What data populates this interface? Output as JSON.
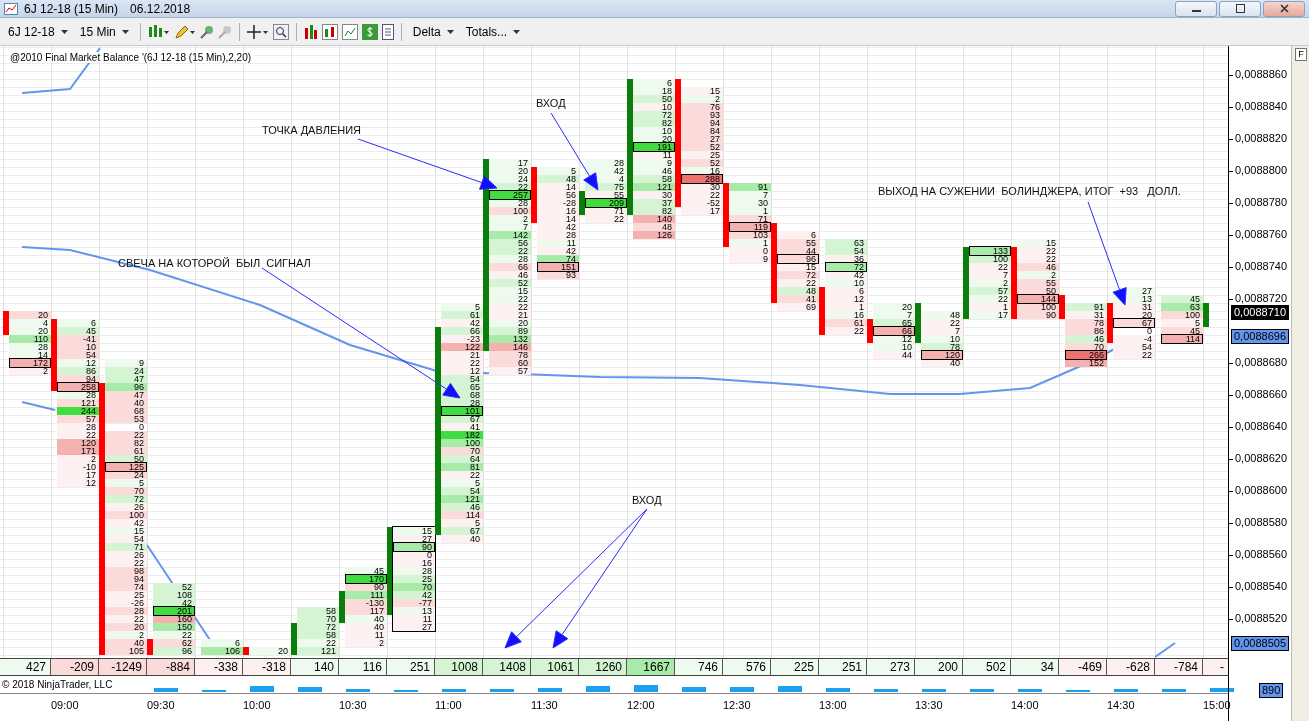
{
  "window": {
    "title": "6J 12-18 (15 Min)",
    "date": "06.12.2018"
  },
  "toolbar": {
    "instrument": "6J 12-18",
    "interval": "15 Min",
    "buttons": [
      "Delta",
      "Totals..."
    ]
  },
  "chart": {
    "indicator_label": "@2010 Final Market Balance  '(6J 12-18 (15 Min),2,20)",
    "options_button": "F",
    "price_labels": [
      "0,0088860",
      "0,0088840",
      "0,0088820",
      "0,0088800",
      "0,0088780",
      "0,0088760",
      "0,0088740",
      "0,0088720",
      "0,0088680",
      "0,0088660",
      "0,0088640",
      "0,0088620",
      "0,0088600",
      "0,0088580",
      "0,0088560",
      "0,0088540",
      "0,0088520"
    ],
    "price_markers": [
      {
        "text": "0,0088710",
        "kind": "last"
      },
      {
        "text": "0,0088696",
        "kind": "indicator"
      },
      {
        "text": "0,0088505",
        "kind": "indicator"
      }
    ],
    "time_labels": [
      "09:00",
      "09:30",
      "10:00",
      "10:30",
      "11:00",
      "11:30",
      "12:00",
      "12:30",
      "13:00",
      "13:30",
      "14:00",
      "14:30",
      "15:00"
    ],
    "annotations": [
      {
        "text": "ТОЧКА ДАВЛЕНИЯ"
      },
      {
        "text": "СВЕЧА НА КОТОРОЙ  БЫЛ  СИГНАЛ"
      },
      {
        "text": "ВХОД"
      },
      {
        "text": "ВХОД"
      },
      {
        "text": "ВЫХОД НА СУЖЕНИИ  БОЛИНДЖЕРА, ИТОГ  +93   ДОЛЛ."
      }
    ],
    "candles": [
      {
        "outlined": false,
        "bullish": false,
        "delta": {
          "text": "427",
          "color": "#effaef"
        },
        "cells": [
          {
            "text": "20",
            "color": "#fbdada",
            "poc": false
          },
          {
            "text": "4",
            "color": "#effaef",
            "poc": false
          },
          {
            "text": "20",
            "color": "#effaef",
            "poc": false
          },
          {
            "text": "110",
            "color": "#a8eba8",
            "poc": false
          },
          {
            "text": "28",
            "color": "#effaef",
            "poc": false
          },
          {
            "text": "14",
            "color": "#effaef",
            "poc": false
          },
          {
            "text": "172",
            "color": "#f5b0b0",
            "poc": true
          },
          {
            "text": "2",
            "color": "#fdf0f0",
            "poc": false
          }
        ]
      },
      {
        "outlined": false,
        "bullish": false,
        "delta": {
          "text": "-209",
          "color": "#fbdada"
        },
        "cells": [
          {
            "text": "6",
            "color": "#effaef",
            "poc": false
          },
          {
            "text": "45",
            "color": "#d4f4d4",
            "poc": false
          },
          {
            "text": "-41",
            "color": "#fbdada",
            "poc": false
          },
          {
            "text": "10",
            "color": "#fbdada",
            "poc": false
          },
          {
            "text": "54",
            "color": "#fbdada",
            "poc": false
          },
          {
            "text": "12",
            "color": "#effaef",
            "poc": false
          },
          {
            "text": "86",
            "color": "#d4f4d4",
            "poc": false
          },
          {
            "text": "94",
            "color": "#fbdada",
            "poc": false
          },
          {
            "text": "258",
            "color": "#f5b0b0",
            "poc": true
          },
          {
            "text": "28",
            "color": "#effaef",
            "poc": false
          },
          {
            "text": "121",
            "color": "#fbdada",
            "poc": false
          },
          {
            "text": "244",
            "color": "#40dc40",
            "poc": false
          },
          {
            "text": "57",
            "color": "#fbdada",
            "poc": false
          },
          {
            "text": "28",
            "color": "#fdf0f0",
            "poc": false
          },
          {
            "text": "22",
            "color": "#fdf0f0",
            "poc": false
          },
          {
            "text": "120",
            "color": "#f5b0b0",
            "poc": false
          },
          {
            "text": "171",
            "color": "#f5b0b0",
            "poc": false
          },
          {
            "text": "2",
            "color": "#fdf0f0",
            "poc": false
          },
          {
            "text": "-10",
            "color": "#fdf0f0",
            "poc": false
          },
          {
            "text": "17",
            "color": "#fdf0f0",
            "poc": false
          },
          {
            "text": "12",
            "color": "#fdf0f0",
            "poc": false
          }
        ]
      },
      {
        "outlined": false,
        "bullish": false,
        "delta": {
          "text": "-1249",
          "color": "#fbdada"
        },
        "cells": [
          {
            "text": "9",
            "color": "#effaef",
            "poc": false
          },
          {
            "text": "24",
            "color": "#d4f4d4",
            "poc": false
          },
          {
            "text": "47",
            "color": "#d4f4d4",
            "poc": false
          },
          {
            "text": "96",
            "color": "#a8eba8",
            "poc": false
          },
          {
            "text": "47",
            "color": "#fbdada",
            "poc": false
          },
          {
            "text": "40",
            "color": "#fbdada",
            "poc": false
          },
          {
            "text": "68",
            "color": "#fbdada",
            "poc": false
          },
          {
            "text": "53",
            "color": "#fbdada",
            "poc": false
          },
          {
            "text": "0",
            "poc": false
          },
          {
            "text": "22",
            "color": "#fbdada",
            "poc": false
          },
          {
            "text": "82",
            "color": "#fbdada",
            "poc": false
          },
          {
            "text": "61",
            "color": "#fbdada",
            "poc": false
          },
          {
            "text": "50",
            "color": "#d4f4d4",
            "poc": false
          },
          {
            "text": "125",
            "color": "#f5b0b0",
            "poc": true
          },
          {
            "text": "24",
            "color": "#fbdada",
            "poc": false
          },
          {
            "text": "5",
            "color": "#effaef",
            "poc": false
          },
          {
            "text": "70",
            "color": "#fbdada",
            "poc": false
          },
          {
            "text": "72",
            "color": "#d4f4d4",
            "poc": false
          },
          {
            "text": "26",
            "color": "#fdf0f0",
            "poc": false
          },
          {
            "text": "100",
            "color": "#fbdada",
            "poc": false
          },
          {
            "text": "42",
            "color": "#fdf0f0",
            "poc": false
          },
          {
            "text": "15",
            "color": "#effaef",
            "poc": false
          },
          {
            "text": "54",
            "color": "#fdf0f0",
            "poc": false
          },
          {
            "text": "71",
            "color": "#d4f4d4",
            "poc": false
          },
          {
            "text": "26",
            "color": "#fdf0f0",
            "poc": false
          },
          {
            "text": "22",
            "color": "#fdf0f0",
            "poc": false
          },
          {
            "text": "98",
            "color": "#fbdada",
            "poc": false
          },
          {
            "text": "94",
            "color": "#fbdada",
            "poc": false
          },
          {
            "text": "74",
            "color": "#fbdada",
            "poc": false
          },
          {
            "text": "25",
            "color": "#fdf0f0",
            "poc": false
          },
          {
            "text": "-26",
            "color": "#fdf0f0",
            "poc": false
          },
          {
            "text": "28",
            "color": "#fbdada",
            "poc": false
          },
          {
            "text": "22",
            "color": "#fdf0f0",
            "poc": false
          },
          {
            "text": "20",
            "color": "#fbdada",
            "poc": false
          },
          {
            "text": "2",
            "color": "#effaef",
            "poc": false
          },
          {
            "text": "40",
            "color": "#fbdada",
            "poc": false
          },
          {
            "text": "105",
            "color": "#fbdada",
            "poc": false
          }
        ]
      },
      {
        "outlined": false,
        "bullish": false,
        "delta": {
          "text": "-884",
          "color": "#fbdada"
        },
        "cells": [
          {
            "text": "52",
            "color": "#d4f4d4",
            "poc": false
          },
          {
            "text": "108",
            "color": "#d4f4d4",
            "poc": false
          },
          {
            "text": "42",
            "color": "#d4f4d4",
            "poc": false
          },
          {
            "text": "201",
            "color": "#40dc40",
            "poc": true
          },
          {
            "text": "160",
            "color": "#f5b0b0",
            "poc": false
          },
          {
            "text": "150",
            "color": "#a8eba8",
            "poc": false
          },
          {
            "text": "22",
            "color": "#effaef",
            "poc": false
          },
          {
            "text": "62",
            "color": "#fbdada",
            "poc": false
          },
          {
            "text": "96",
            "color": "#d4f4d4",
            "poc": false
          }
        ]
      },
      {
        "outlined": false,
        "delta": {
          "text": "-338",
          "color": "#fdf0f0"
        },
        "cells": [
          {
            "text": "6",
            "color": "#effaef",
            "poc": false
          },
          {
            "text": "106",
            "color": "#a8eba8",
            "poc": false
          }
        ]
      },
      {
        "outlined": false,
        "bullish": false,
        "delta": {
          "text": "-318",
          "color": "#fdf0f0"
        },
        "cells": [
          {
            "text": "20",
            "color": "#effaef",
            "poc": false
          }
        ]
      },
      {
        "outlined": false,
        "bullish": true,
        "delta": {
          "text": "140",
          "color": "#effaef"
        },
        "cells": [
          {
            "text": "58",
            "color": "#d4f4d4",
            "poc": false
          },
          {
            "text": "70",
            "color": "#d4f4d4",
            "poc": false
          },
          {
            "text": "72",
            "color": "#d4f4d4",
            "poc": false
          },
          {
            "text": "58",
            "color": "#d4f4d4",
            "poc": false
          },
          {
            "text": "22",
            "color": "#effaef",
            "poc": false
          },
          {
            "text": "121",
            "color": "#d4f4d4",
            "poc": false
          }
        ]
      },
      {
        "outlined": false,
        "bullish": true,
        "delta": {
          "text": "116",
          "color": "#effaef"
        },
        "cells": [
          {
            "text": "45",
            "color": "#effaef",
            "poc": false
          },
          {
            "text": "170",
            "color": "#40dc40",
            "poc": true
          },
          {
            "text": "90",
            "color": "#fbdada",
            "poc": false
          },
          {
            "text": "111",
            "color": "#a8eba8",
            "poc": false
          },
          {
            "text": "-130",
            "color": "#fbdada",
            "poc": false
          },
          {
            "text": "117",
            "color": "#fbdada",
            "poc": false
          },
          {
            "text": "40",
            "color": "#effaef",
            "poc": false
          },
          {
            "text": "40",
            "color": "#fdf0f0",
            "poc": false
          },
          {
            "text": "11",
            "color": "#fdf0f0",
            "poc": false
          },
          {
            "text": "2",
            "color": "#fdf0f0",
            "poc": false
          }
        ]
      },
      {
        "outlined": true,
        "bullish": true,
        "delta": {
          "text": "251",
          "color": "#effaef"
        },
        "cells": [
          {
            "text": "15",
            "color": "#effaef",
            "poc": false
          },
          {
            "text": "27",
            "color": "#fdf0f0",
            "poc": false
          },
          {
            "text": "90",
            "color": "#a8eba8",
            "poc": true
          },
          {
            "text": "0",
            "color": "#fdf0f0",
            "poc": false
          },
          {
            "text": "16",
            "color": "#fdf0f0",
            "poc": false
          },
          {
            "text": "28",
            "color": "#effaef",
            "poc": false
          },
          {
            "text": "25",
            "color": "#d4f4d4",
            "poc": false
          },
          {
            "text": "70",
            "color": "#a8eba8",
            "poc": false
          },
          {
            "text": "42",
            "color": "#d4f4d4",
            "poc": false
          },
          {
            "text": "-77",
            "color": "#fbdada",
            "poc": false
          },
          {
            "text": "13",
            "color": "#effaef",
            "poc": false
          },
          {
            "text": "11",
            "color": "#fdf0f0",
            "poc": false
          },
          {
            "text": "27",
            "color": "#fdf0f0",
            "poc": false
          }
        ]
      },
      {
        "outlined": false,
        "bullish": true,
        "delta": {
          "text": "1008",
          "color": "#d4f4d4"
        },
        "cells": [
          {
            "text": "5",
            "color": "#effaef",
            "poc": false
          },
          {
            "text": "61",
            "color": "#d4f4d4",
            "poc": false
          },
          {
            "text": "42",
            "color": "#fdf0f0",
            "poc": false
          },
          {
            "text": "66",
            "color": "#d4f4d4",
            "poc": false
          },
          {
            "text": "-23",
            "color": "#fdf0f0",
            "poc": false
          },
          {
            "text": "122",
            "color": "#f5b0b0",
            "poc": false
          },
          {
            "text": "21",
            "color": "#fdf0f0",
            "poc": false
          },
          {
            "text": "22",
            "color": "#fdf0f0",
            "poc": false
          },
          {
            "text": "12",
            "color": "#fdf0f0",
            "poc": false
          },
          {
            "text": "54",
            "color": "#d4f4d4",
            "poc": false
          },
          {
            "text": "65",
            "color": "#d4f4d4",
            "poc": false
          },
          {
            "text": "68",
            "color": "#d4f4d4",
            "poc": false
          },
          {
            "text": "28",
            "color": "#d4f4d4",
            "poc": false
          },
          {
            "text": "101",
            "color": "#40dc40",
            "poc": true
          },
          {
            "text": "67",
            "color": "#d4f4d4",
            "poc": false
          },
          {
            "text": "41",
            "color": "#fdf0f0",
            "poc": false
          },
          {
            "text": "182",
            "color": "#40dc40",
            "poc": false
          },
          {
            "text": "100",
            "color": "#a8eba8",
            "poc": false
          },
          {
            "text": "70",
            "color": "#fbdada",
            "poc": false
          },
          {
            "text": "64",
            "color": "#d4f4d4",
            "poc": false
          },
          {
            "text": "81",
            "color": "#a8eba8",
            "poc": false
          },
          {
            "text": "22",
            "color": "#fdf0f0",
            "poc": false
          },
          {
            "text": "5",
            "color": "#effaef",
            "poc": false
          },
          {
            "text": "54",
            "color": "#d4f4d4",
            "poc": false
          },
          {
            "text": "121",
            "color": "#a8eba8",
            "poc": false
          },
          {
            "text": "46",
            "color": "#d4f4d4",
            "poc": false
          },
          {
            "text": "114",
            "color": "#fbdada",
            "poc": false
          },
          {
            "text": "5",
            "color": "#fdf0f0",
            "poc": false
          },
          {
            "text": "67",
            "color": "#d4f4d4",
            "poc": false
          },
          {
            "text": "40",
            "color": "#fdf0f0",
            "poc": false
          }
        ]
      },
      {
        "outlined": false,
        "bullish": true,
        "delta": {
          "text": "1408",
          "color": "#d4f4d4"
        },
        "cells": [
          {
            "text": "17",
            "color": "#effaef",
            "poc": false
          },
          {
            "text": "20",
            "color": "#effaef",
            "poc": false
          },
          {
            "text": "24",
            "color": "#effaef",
            "poc": false
          },
          {
            "text": "22",
            "color": "#d4f4d4",
            "poc": false
          },
          {
            "text": "257",
            "color": "#40dc40",
            "poc": true
          },
          {
            "text": "28",
            "color": "#effaef",
            "poc": false
          },
          {
            "text": "100",
            "color": "#fbdada",
            "poc": false
          },
          {
            "text": "2",
            "color": "#effaef",
            "poc": false
          },
          {
            "text": "7",
            "color": "#effaef",
            "poc": false
          },
          {
            "text": "142",
            "color": "#a8eba8",
            "poc": false
          },
          {
            "text": "56",
            "color": "#d4f4d4",
            "poc": false
          },
          {
            "text": "22",
            "color": "#d4f4d4",
            "poc": false
          },
          {
            "text": "28",
            "color": "#effaef",
            "poc": false
          },
          {
            "text": "66",
            "color": "#fbdada",
            "poc": false
          },
          {
            "text": "46",
            "color": "#fdf0f0",
            "poc": false
          },
          {
            "text": "52",
            "color": "#d4f4d4",
            "poc": false
          },
          {
            "text": "15",
            "color": "#effaef",
            "poc": false
          },
          {
            "text": "22",
            "color": "#effaef",
            "poc": false
          },
          {
            "text": "22",
            "color": "#fdf0f0",
            "poc": false
          },
          {
            "text": "21",
            "color": "#fdf0f0",
            "poc": false
          },
          {
            "text": "20",
            "color": "#effaef",
            "poc": false
          },
          {
            "text": "89",
            "color": "#d4f4d4",
            "poc": false
          },
          {
            "text": "132",
            "color": "#a8eba8",
            "poc": false
          },
          {
            "text": "146",
            "color": "#f5b0b0",
            "poc": false
          },
          {
            "text": "78",
            "color": "#fbdada",
            "poc": false
          },
          {
            "text": "60",
            "color": "#fbdada",
            "poc": false
          },
          {
            "text": "57",
            "color": "#fdf0f0",
            "poc": false
          }
        ]
      },
      {
        "outlined": false,
        "bullish": false,
        "delta": {
          "text": "1061",
          "color": "#d4f4d4"
        },
        "cells": [
          {
            "text": "5",
            "color": "#effaef",
            "poc": false
          },
          {
            "text": "48",
            "color": "#d4f4d4",
            "poc": false
          },
          {
            "text": "14",
            "color": "#fdf0f0",
            "poc": false
          },
          {
            "text": "56",
            "color": "#fdf0f0",
            "poc": false
          },
          {
            "text": "-28",
            "color": "#fdf0f0",
            "poc": false
          },
          {
            "text": "16",
            "color": "#fdf0f0",
            "poc": false
          },
          {
            "text": "14",
            "color": "#fdf0f0",
            "poc": false
          },
          {
            "text": "42",
            "color": "#fdf0f0",
            "poc": false
          },
          {
            "text": "28",
            "color": "#fdf0f0",
            "poc": false
          },
          {
            "text": "11",
            "color": "#effaef",
            "poc": false
          },
          {
            "text": "42",
            "color": "#fdf0f0",
            "poc": false
          },
          {
            "text": "74",
            "color": "#a8eba8",
            "poc": false
          },
          {
            "text": "151",
            "color": "#f5b0b0",
            "poc": true
          },
          {
            "text": "93",
            "color": "#fbdada",
            "poc": false
          }
        ]
      },
      {
        "outlined": false,
        "bullish": true,
        "delta": {
          "text": "1260",
          "color": "#d4f4d4"
        },
        "cells": [
          {
            "text": "28",
            "color": "#effaef",
            "poc": false
          },
          {
            "text": "42",
            "color": "#effaef",
            "poc": false
          },
          {
            "text": "4",
            "color": "#effaef",
            "poc": false
          },
          {
            "text": "75",
            "color": "#d4f4d4",
            "poc": false
          },
          {
            "text": "55",
            "color": "#fdf0f0",
            "poc": false
          },
          {
            "text": "209",
            "color": "#40dc40",
            "poc": true
          },
          {
            "text": "71",
            "color": "#fdf0f0",
            "poc": false
          },
          {
            "text": "22",
            "color": "#fdf0f0",
            "poc": false
          }
        ]
      },
      {
        "outlined": false,
        "bullish": true,
        "delta": {
          "text": "1667",
          "color": "#a8eba8"
        },
        "cells": [
          {
            "text": "6",
            "color": "#effaef",
            "poc": false
          },
          {
            "text": "18",
            "color": "#effaef",
            "poc": false
          },
          {
            "text": "50",
            "color": "#d4f4d4",
            "poc": false
          },
          {
            "text": "10",
            "color": "#fdf0f0",
            "poc": false
          },
          {
            "text": "72",
            "color": "#d4f4d4",
            "poc": false
          },
          {
            "text": "82",
            "color": "#d4f4d4",
            "poc": false
          },
          {
            "text": "10",
            "color": "#effaef",
            "poc": false
          },
          {
            "text": "20",
            "color": "#effaef",
            "poc": false
          },
          {
            "text": "191",
            "color": "#40dc40",
            "poc": true
          },
          {
            "text": "11",
            "color": "#fdf0f0",
            "poc": false
          },
          {
            "text": "9",
            "color": "#effaef",
            "poc": false
          },
          {
            "text": "46",
            "color": "#effaef",
            "poc": false
          },
          {
            "text": "58",
            "color": "#d4f4d4",
            "poc": false
          },
          {
            "text": "121",
            "color": "#a8eba8",
            "poc": false
          },
          {
            "text": "30",
            "color": "#fdf0f0",
            "poc": false
          },
          {
            "text": "37",
            "color": "#d4f4d4",
            "poc": false
          },
          {
            "text": "82",
            "color": "#d4f4d4",
            "poc": false
          },
          {
            "text": "140",
            "color": "#f5b0b0",
            "poc": false
          },
          {
            "text": "48",
            "color": "#fbdada",
            "poc": false
          },
          {
            "text": "126",
            "color": "#f5b0b0",
            "poc": false
          }
        ]
      },
      {
        "outlined": false,
        "bullish": false,
        "delta": {
          "text": "746",
          "color": "#effaef"
        },
        "cells": [
          {
            "text": "15",
            "color": "#fdf0f0",
            "poc": false
          },
          {
            "text": "2",
            "color": "#effaef",
            "poc": false
          },
          {
            "text": "76",
            "color": "#fbdada",
            "poc": false
          },
          {
            "text": "93",
            "color": "#fbdada",
            "poc": false
          },
          {
            "text": "94",
            "color": "#fbdada",
            "poc": false
          },
          {
            "text": "84",
            "color": "#fbdada",
            "poc": false
          },
          {
            "text": "27",
            "color": "#fbdada",
            "poc": false
          },
          {
            "text": "52",
            "color": "#fbdada",
            "poc": false
          },
          {
            "text": "25",
            "color": "#fdf0f0",
            "poc": false
          },
          {
            "text": "52",
            "color": "#fbdada",
            "poc": false
          },
          {
            "text": "16",
            "color": "#effaef",
            "poc": false
          },
          {
            "text": "288",
            "color": "#ef7272",
            "poc": true
          },
          {
            "text": "30",
            "color": "#fdf0f0",
            "poc": false
          },
          {
            "text": "22",
            "color": "#fdf0f0",
            "poc": false
          },
          {
            "text": "-52",
            "color": "#fdf0f0",
            "poc": false
          },
          {
            "text": "17",
            "color": "#fdf0f0",
            "poc": false
          }
        ]
      },
      {
        "outlined": false,
        "bullish": false,
        "delta": {
          "text": "576",
          "color": "#effaef"
        },
        "cells": [
          {
            "text": "91",
            "color": "#a8eba8",
            "poc": false
          },
          {
            "text": "7",
            "color": "#effaef",
            "poc": false
          },
          {
            "text": "30",
            "color": "#effaef",
            "poc": false
          },
          {
            "text": "1",
            "color": "#effaef",
            "poc": false
          },
          {
            "text": "71",
            "color": "#fbdada",
            "poc": false
          },
          {
            "text": "119",
            "color": "#f5b0b0",
            "poc": true
          },
          {
            "text": "103",
            "color": "#fbdada",
            "poc": false
          },
          {
            "text": "1",
            "color": "#effaef",
            "poc": false
          },
          {
            "text": "0",
            "color": "#fdf0f0",
            "poc": false
          },
          {
            "text": "9",
            "color": "#fdf0f0",
            "poc": false
          }
        ]
      },
      {
        "outlined": false,
        "bullish": false,
        "delta": {
          "text": "225",
          "color": "#effaef"
        },
        "cells": [
          {
            "text": "6",
            "color": "#fdf0f0",
            "poc": false
          },
          {
            "text": "55",
            "color": "#fbdada",
            "poc": false
          },
          {
            "text": "44",
            "color": "#fbdada",
            "poc": false
          },
          {
            "text": "96",
            "color": "#fbdada",
            "poc": true
          },
          {
            "text": "15",
            "color": "#fdf0f0",
            "poc": false
          },
          {
            "text": "72",
            "color": "#fbdada",
            "poc": false
          },
          {
            "text": "22",
            "color": "#fdf0f0",
            "poc": false
          },
          {
            "text": "48",
            "color": "#d4f4d4",
            "poc": false
          },
          {
            "text": "41",
            "color": "#fbdada",
            "poc": false
          },
          {
            "text": "69",
            "color": "#fdf0f0",
            "poc": false
          }
        ]
      },
      {
        "outlined": false,
        "bullish": false,
        "delta": {
          "text": "251",
          "color": "#effaef"
        },
        "cells": [
          {
            "text": "63",
            "color": "#d4f4d4",
            "poc": false
          },
          {
            "text": "54",
            "color": "#d4f4d4",
            "poc": false
          },
          {
            "text": "36",
            "color": "#fdf0f0",
            "poc": false
          },
          {
            "text": "72",
            "color": "#a8eba8",
            "poc": true
          },
          {
            "text": "42",
            "color": "#fdf0f0",
            "poc": false
          },
          {
            "text": "10",
            "color": "#effaef",
            "poc": false
          },
          {
            "text": "6",
            "color": "#fdf0f0",
            "poc": false
          },
          {
            "text": "12",
            "color": "#fdf0f0",
            "poc": false
          },
          {
            "text": "1",
            "color": "#fdf0f0",
            "poc": false
          },
          {
            "text": "16",
            "color": "#effaef",
            "poc": false
          },
          {
            "text": "61",
            "color": "#fbdada",
            "poc": false
          },
          {
            "text": "22",
            "color": "#fdf0f0",
            "poc": false
          }
        ]
      },
      {
        "outlined": false,
        "bullish": false,
        "delta": {
          "text": "273",
          "color": "#effaef"
        },
        "cells": [
          {
            "text": "20",
            "color": "#effaef",
            "poc": false
          },
          {
            "text": "7",
            "color": "#effaef",
            "poc": false
          },
          {
            "text": "65",
            "color": "#d4f4d4",
            "poc": false
          },
          {
            "text": "66",
            "color": "#f5b0b0",
            "poc": true
          },
          {
            "text": "12",
            "color": "#effaef",
            "poc": false
          },
          {
            "text": "10",
            "color": "#effaef",
            "poc": false
          },
          {
            "text": "44",
            "color": "#fdf0f0",
            "poc": false
          }
        ]
      },
      {
        "outlined": false,
        "bullish": true,
        "delta": {
          "text": "200",
          "color": "#effaef"
        },
        "cells": [
          {
            "text": "48",
            "color": "#effaef",
            "poc": false
          },
          {
            "text": "22",
            "color": "#fdf0f0",
            "poc": false
          },
          {
            "text": "7",
            "color": "#fdf0f0",
            "poc": false
          },
          {
            "text": "10",
            "color": "#effaef",
            "poc": false
          },
          {
            "text": "78",
            "color": "#d4f4d4",
            "poc": false
          },
          {
            "text": "120",
            "color": "#f5b0b0",
            "poc": true
          },
          {
            "text": "40",
            "color": "#fdf0f0",
            "poc": false
          }
        ]
      },
      {
        "outlined": false,
        "bullish": true,
        "delta": {
          "text": "502",
          "color": "#effaef"
        },
        "cells": [
          {
            "text": "133",
            "color": "#a8eba8",
            "poc": true
          },
          {
            "text": "100",
            "color": "#d4f4d4",
            "poc": false
          },
          {
            "text": "22",
            "color": "#fdf0f0",
            "poc": false
          },
          {
            "text": "7",
            "color": "#fdf0f0",
            "poc": false
          },
          {
            "text": "2",
            "color": "#effaef",
            "poc": false
          },
          {
            "text": "57",
            "color": "#d4f4d4",
            "poc": false
          },
          {
            "text": "22",
            "color": "#effaef",
            "poc": false
          },
          {
            "text": "1",
            "color": "#fdf0f0",
            "poc": false
          },
          {
            "text": "17",
            "color": "#effaef",
            "poc": false
          }
        ]
      },
      {
        "outlined": false,
        "bullish": false,
        "delta": {
          "text": "34",
          "color": "#effaef"
        },
        "cells": [
          {
            "text": "15",
            "color": "#effaef",
            "poc": false
          },
          {
            "text": "22",
            "color": "#fdf0f0",
            "poc": false
          },
          {
            "text": "22",
            "color": "#fdf0f0",
            "poc": false
          },
          {
            "text": "46",
            "color": "#fbdada",
            "poc": false
          },
          {
            "text": "2",
            "color": "#effaef",
            "poc": false
          },
          {
            "text": "55",
            "color": "#fbdada",
            "poc": false
          },
          {
            "text": "50",
            "color": "#fbdada",
            "poc": false
          },
          {
            "text": "144",
            "color": "#f5b0b0",
            "poc": true
          },
          {
            "text": "100",
            "color": "#fbdada",
            "poc": false
          },
          {
            "text": "90",
            "color": "#fbdada",
            "poc": false
          }
        ]
      },
      {
        "outlined": false,
        "bullish": false,
        "delta": {
          "text": "-469",
          "color": "#fdf0f0"
        },
        "cells": [
          {
            "text": "91",
            "color": "#d4f4d4",
            "poc": false
          },
          {
            "text": "31",
            "color": "#fdf0f0",
            "poc": false
          },
          {
            "text": "78",
            "color": "#fbdada",
            "poc": false
          },
          {
            "text": "86",
            "color": "#fbdada",
            "poc": false
          },
          {
            "text": "46",
            "color": "#d4f4d4",
            "poc": false
          },
          {
            "text": "70",
            "color": "#fbdada",
            "poc": false
          },
          {
            "text": "266",
            "color": "#ef7272",
            "poc": true
          },
          {
            "text": "152",
            "color": "#f5b0b0",
            "poc": false
          }
        ]
      },
      {
        "outlined": false,
        "bullish": false,
        "delta": {
          "text": "-628",
          "color": "#fdf0f0"
        },
        "cells": [
          {
            "text": "27",
            "color": "#effaef",
            "poc": false
          },
          {
            "text": "13",
            "color": "#effaef",
            "poc": false
          },
          {
            "text": "31",
            "color": "#fdf0f0",
            "poc": false
          },
          {
            "text": "20",
            "color": "#fdf0f0",
            "poc": false
          },
          {
            "text": "67",
            "color": "#fbdada",
            "poc": true
          },
          {
            "text": "0",
            "poc": false
          },
          {
            "text": "-4",
            "color": "#fdf0f0",
            "poc": false
          },
          {
            "text": "54",
            "color": "#fdf0f0",
            "poc": false
          },
          {
            "text": "22",
            "color": "#fdf0f0",
            "poc": false
          }
        ]
      },
      {
        "outlined": false,
        "delta": {
          "text": "-784",
          "color": "#fdf0f0"
        },
        "cells": [
          {
            "text": "45",
            "color": "#d4f4d4",
            "poc": false
          },
          {
            "text": "63",
            "color": "#a8eba8",
            "poc": false
          },
          {
            "text": "100",
            "color": "#fbdada",
            "poc": false
          },
          {
            "text": "5",
            "color": "#fdf0f0",
            "poc": false
          },
          {
            "text": "45",
            "color": "#fbdada",
            "poc": false
          },
          {
            "text": "114",
            "color": "#f5b0b0",
            "poc": true
          }
        ]
      },
      {
        "bullish": true,
        "delta": {
          "text": "-",
          "color": "#fdf0f0"
        }
      }
    ]
  },
  "footer": {
    "copyright": "© 2018 NinjaTrader, LLC",
    "volume_label": "890"
  }
}
